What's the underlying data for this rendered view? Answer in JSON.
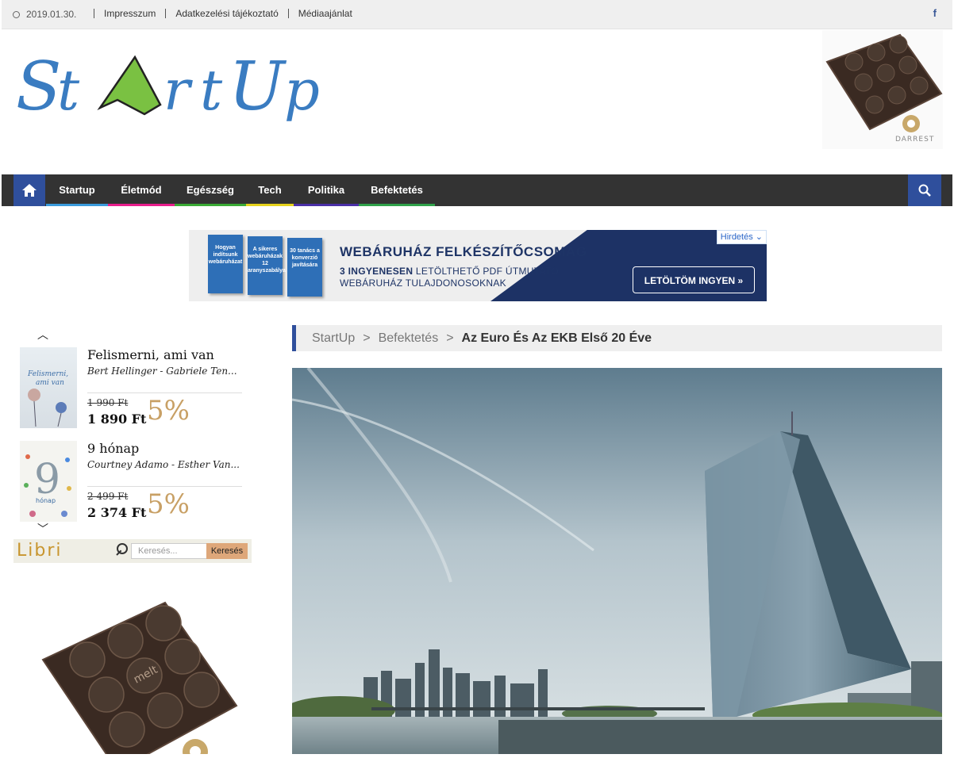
{
  "topbar": {
    "date": "2019.01.30.",
    "links": [
      "Impresszum",
      "Adatkezelési tájékoztató",
      "Médiaajánlat"
    ],
    "facebook": "f"
  },
  "logo": {
    "text": "StArtUp"
  },
  "nav": {
    "items": [
      {
        "label": "Startup",
        "color": "#3a9bdc"
      },
      {
        "label": "Életmód",
        "color": "#e91e8c"
      },
      {
        "label": "Egészség",
        "color": "#3aaa35"
      },
      {
        "label": "Tech",
        "color": "#e6d21c"
      },
      {
        "label": "Politika",
        "color": "#4a2fa6"
      },
      {
        "label": "Befektetés",
        "color": "#2fa14a"
      }
    ],
    "home_icon": "home-icon",
    "search_icon": "search-icon"
  },
  "banner": {
    "title": "WEBÁRUHÁZ FELKÉSZÍTŐCSOMAG",
    "sub_bold": "3 INGYENESEN",
    "sub_rest": " LETÖLTHETŐ PDF ÚTMUTATÓ",
    "sub_line2": "WEBÁRUHÁZ TULAJDONOSOKNAK",
    "button": "LETÖLTÖM INGYEN »",
    "ad_tag": "Hirdetés ⌄",
    "books": [
      "Hogyan indítsunk webáruházat",
      "A sikeres webáruházak 12 aranyszabálya",
      "30 tanács a konverzió javítására"
    ]
  },
  "libri": {
    "books": [
      {
        "title": "Felismerni, ami van",
        "author": "Bert Hellinger - Gabriele Ten...",
        "old_price": "1 990 Ft",
        "new_price": "1 890 Ft",
        "discount": "5%"
      },
      {
        "title": "9 hónap",
        "author": "Courtney Adamo - Esther Van...",
        "old_price": "2 499 Ft",
        "new_price": "2 374 Ft",
        "discount": "5%"
      }
    ],
    "brand": "Libri",
    "search_placeholder": "Keresés...",
    "search_button": "Keresés",
    "up_arrow": "︿",
    "down_arrow": "﹀"
  },
  "breadcrumb": {
    "items": [
      "StartUp",
      "Befektetés"
    ],
    "separator": ">",
    "current": "Az Euro És Az EKB Első 20 Éve"
  },
  "ads": {
    "chocolate_brand": "DARREST",
    "chocolate_text": "melt"
  }
}
